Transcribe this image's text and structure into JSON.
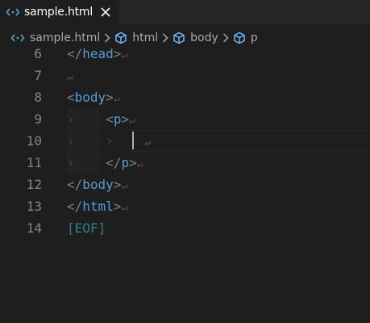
{
  "tab": {
    "label": "sample.html",
    "icon": "html-file-icon",
    "close_icon": "close-icon"
  },
  "breadcrumb": {
    "items": [
      {
        "label": "sample.html",
        "icon": "html-file-icon"
      },
      {
        "label": "html",
        "icon": "cube-icon"
      },
      {
        "label": "body",
        "icon": "cube-icon"
      },
      {
        "label": "p",
        "icon": "cube-icon"
      }
    ]
  },
  "editor": {
    "current_line": 10,
    "lines": [
      {
        "num": "6",
        "open": "</",
        "tag": "head",
        "close": ">",
        "eol": "↵"
      },
      {
        "num": "7",
        "eol": "↵"
      },
      {
        "num": "8",
        "open": "<",
        "tag": "body",
        "close": ">",
        "eol": "↵"
      },
      {
        "num": "9",
        "guide": "›",
        "open": "<",
        "tag": "p",
        "close": ">",
        "eol": "↵"
      },
      {
        "num": "10",
        "guide": "›",
        "guide2": "›",
        "eol": "↵"
      },
      {
        "num": "11",
        "guide": "›",
        "open": "</",
        "tag": "p",
        "close": ">",
        "eol": "↵"
      },
      {
        "num": "12",
        "open": "</",
        "tag": "body",
        "close": ">",
        "eol": "↵"
      },
      {
        "num": "13",
        "open": "</",
        "tag": "html",
        "close": ">",
        "eol": "↵"
      },
      {
        "num": "14",
        "eof": "[EOF]"
      }
    ]
  },
  "colors": {
    "background": "#1e1e1e",
    "tag": "#569cd6",
    "punctuation": "#808080",
    "eol_marker": "#6e4a4a",
    "eof": "#2f7f8f",
    "line_number": "#858585",
    "html_icon": "#519aba"
  }
}
